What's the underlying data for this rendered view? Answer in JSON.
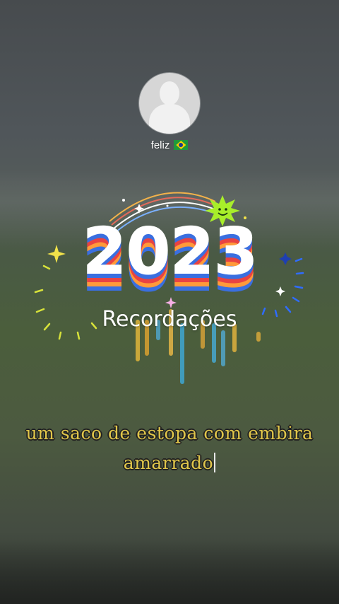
{
  "profile": {
    "username": "feliz",
    "flag_icon": "brazil-flag-icon"
  },
  "title": {
    "year": "2023",
    "subtitle": "Recordações"
  },
  "caption": {
    "line1": "um saco de estopa com embira",
    "line2": "amarrado"
  },
  "colors": {
    "year_fill": "#ffffff",
    "year_layer_red": "#e84343",
    "year_layer_blue": "#3a6fe0",
    "year_layer_orange": "#ff9a3a",
    "caption_text": "#e0c64a",
    "sparkle_yellow": "#f2e24a",
    "sparkle_blue": "#2f6cff",
    "smiley_green": "#a8ee2a"
  }
}
